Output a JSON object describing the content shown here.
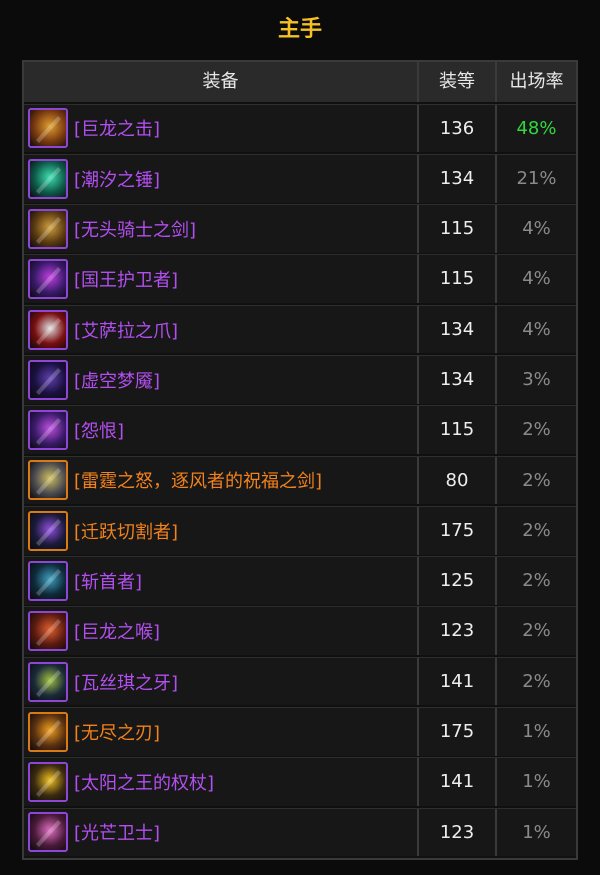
{
  "title": "主手",
  "header": {
    "col_item": "装备",
    "col_level": "装等",
    "col_rate": "出场率"
  },
  "colors": {
    "epic": "#b34ff0",
    "legendary": "#f2821c",
    "highlight": "#2fd83c"
  },
  "rows": [
    {
      "name": "[巨龙之击]",
      "level": "136",
      "rate": "48%",
      "quality": "epic",
      "icon": "dragon-weapon-icon"
    },
    {
      "name": "[潮汐之锤]",
      "level": "134",
      "rate": "21%",
      "quality": "epic",
      "icon": "tide-hammer-icon"
    },
    {
      "name": "[无头骑士之剑]",
      "level": "115",
      "rate": "4%",
      "quality": "epic",
      "icon": "headless-sword-icon"
    },
    {
      "name": "[国王护卫者]",
      "level": "115",
      "rate": "4%",
      "quality": "epic",
      "icon": "kings-defender-icon"
    },
    {
      "name": "[艾萨拉之爪]",
      "level": "134",
      "rate": "4%",
      "quality": "epic",
      "icon": "azshara-claw-icon"
    },
    {
      "name": "[虚空梦魇]",
      "level": "134",
      "rate": "3%",
      "quality": "epic",
      "icon": "void-nightmare-icon"
    },
    {
      "name": "[怨恨]",
      "level": "115",
      "rate": "2%",
      "quality": "epic",
      "icon": "grudge-icon"
    },
    {
      "name": "[雷霆之怒，逐风者的祝福之剑]",
      "level": "80",
      "rate": "2%",
      "quality": "legendary",
      "icon": "thunderfury-icon"
    },
    {
      "name": "[迁跃切割者]",
      "level": "175",
      "rate": "2%",
      "quality": "legendary",
      "icon": "warp-slicer-icon"
    },
    {
      "name": "[斩首者]",
      "level": "125",
      "rate": "2%",
      "quality": "epic",
      "icon": "decapitator-icon"
    },
    {
      "name": "[巨龙之喉]",
      "level": "123",
      "rate": "2%",
      "quality": "epic",
      "icon": "dragon-maw-icon"
    },
    {
      "name": "[瓦丝琪之牙]",
      "level": "141",
      "rate": "2%",
      "quality": "epic",
      "icon": "vashj-fang-icon"
    },
    {
      "name": "[无尽之刃]",
      "level": "175",
      "rate": "1%",
      "quality": "legendary",
      "icon": "infinity-blade-icon"
    },
    {
      "name": "[太阳之王的权杖]",
      "level": "141",
      "rate": "1%",
      "quality": "epic",
      "icon": "sun-king-scepter-icon"
    },
    {
      "name": "[光芒卫士]",
      "level": "123",
      "rate": "1%",
      "quality": "epic",
      "icon": "lightbringer-guard-icon"
    }
  ]
}
